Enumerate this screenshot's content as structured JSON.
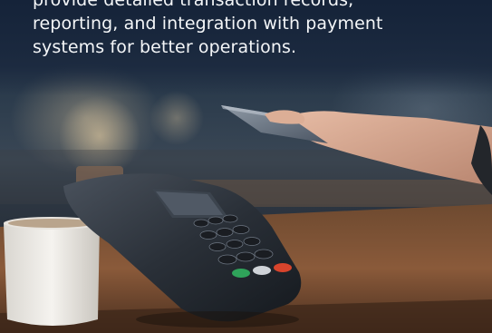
{
  "slide": {
    "caption_lines": [
      "provide detailed transaction records,",
      "reporting, and integration with payment",
      "systems for better operations."
    ]
  },
  "photo": {
    "subject": "hand tapping a card on a countertop payment terminal beside a white mug",
    "colors": {
      "overlay": "#1a2a40",
      "terminal": "#2e3540",
      "counter": "#8a5a3a",
      "mug": "#f2f0ec",
      "key_green": "#2fa35a",
      "key_red": "#d8442c"
    }
  }
}
